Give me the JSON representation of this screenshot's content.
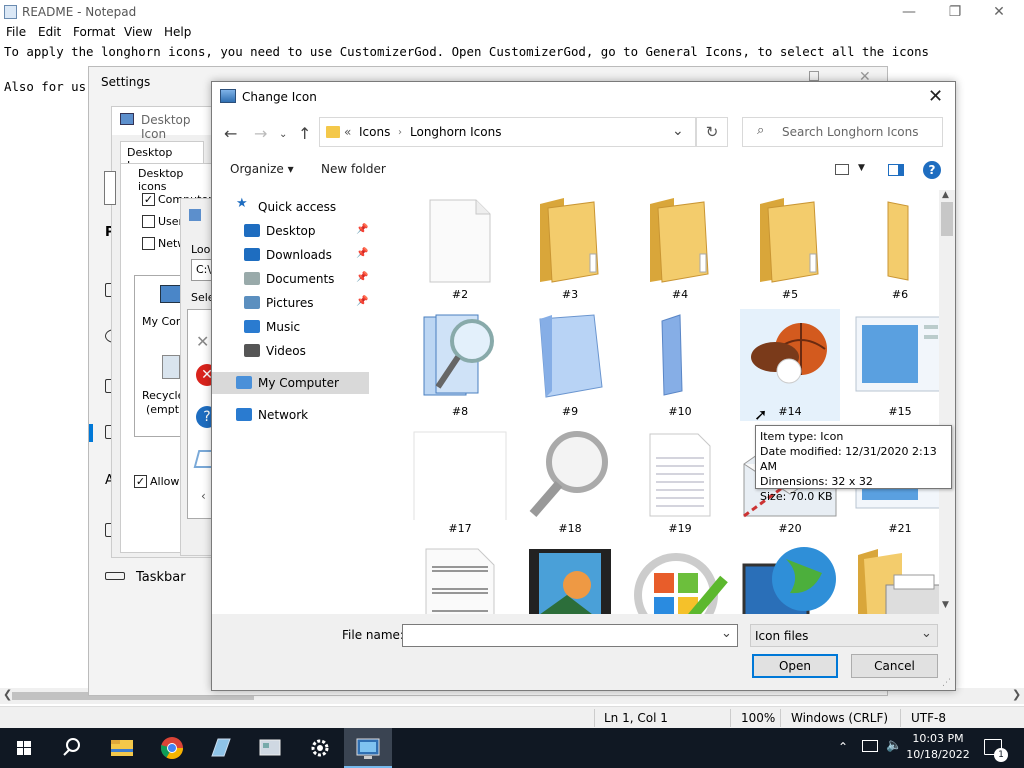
{
  "notepad": {
    "title": "README - Notepad",
    "menu": [
      "File",
      "Edit",
      "Format",
      "View",
      "Help"
    ],
    "line1": "To apply the longhorn icons, you need to use CustomizerGod. Open CustomizerGod, go to General Icons, to select all the icons",
    "line2": "Also for us",
    "status": {
      "pos": "Ln 1, Col 1",
      "zoom": "100%",
      "eol": "Windows (CRLF)",
      "enc": "UTF-8"
    }
  },
  "settings": {
    "title": "Settings",
    "taskbar_label": "Taskbar",
    "nav_letters": [
      "P",
      "A"
    ]
  },
  "desktop_icons": {
    "title": "Desktop Icon",
    "tab": "Desktop Icons",
    "group": "Desktop icons",
    "checks": [
      {
        "label": "Computer",
        "checked": true
      },
      {
        "label": "User",
        "checked": false
      },
      {
        "label": "Netw",
        "checked": false
      }
    ],
    "icons": [
      "My Comp",
      "Recycle",
      "(empt"
    ],
    "allow": "Allow t"
  },
  "look": {
    "label": "Look",
    "path": "C:\\",
    "select": "Selec"
  },
  "dialog": {
    "title": "Change Icon",
    "address": {
      "sep": "«",
      "parts": [
        "Icons",
        "Longhorn Icons"
      ]
    },
    "search_placeholder": "Search Longhorn Icons",
    "organize": "Organize ▾",
    "new_folder": "New folder",
    "sidebar": [
      {
        "label": "Quick access",
        "icon": "star-icon"
      },
      {
        "label": "Desktop",
        "icon": "desktop-icon",
        "pinned": true
      },
      {
        "label": "Downloads",
        "icon": "download-icon",
        "pinned": true
      },
      {
        "label": "Documents",
        "icon": "documents-icon",
        "pinned": true
      },
      {
        "label": "Pictures",
        "icon": "pictures-icon",
        "pinned": true
      },
      {
        "label": "Music",
        "icon": "music-icon"
      },
      {
        "label": "Videos",
        "icon": "videos-icon"
      },
      {
        "label": "My Computer",
        "icon": "computer-icon",
        "selected": true
      },
      {
        "label": "Network",
        "icon": "network-icon"
      }
    ],
    "items": [
      {
        "label": "#2",
        "kind": "blank-page"
      },
      {
        "label": "#3",
        "kind": "folder"
      },
      {
        "label": "#4",
        "kind": "folder"
      },
      {
        "label": "#5",
        "kind": "folder"
      },
      {
        "label": "#6",
        "kind": "folder-side"
      },
      {
        "label": "#8",
        "kind": "search-pages"
      },
      {
        "label": "#9",
        "kind": "blue-folder"
      },
      {
        "label": "#10",
        "kind": "blue-folder-side"
      },
      {
        "label": "#14",
        "kind": "balls"
      },
      {
        "label": "#15",
        "kind": "window"
      },
      {
        "label": "#17",
        "kind": "blank-box"
      },
      {
        "label": "#18",
        "kind": "magnifier"
      },
      {
        "label": "#19",
        "kind": "lined-page"
      },
      {
        "label": "#20",
        "kind": "envelope"
      },
      {
        "label": "#21",
        "kind": "window"
      },
      {
        "label": "",
        "kind": "sheet-music"
      },
      {
        "label": "",
        "kind": "film"
      },
      {
        "label": "",
        "kind": "windows-check"
      },
      {
        "label": "",
        "kind": "globe-monitor"
      },
      {
        "label": "",
        "kind": "folder-printer"
      }
    ],
    "file_name_label": "File name:",
    "file_name_value": "",
    "file_type": "Icon files",
    "open": "Open",
    "cancel": "Cancel",
    "tooltip": [
      "Item type: Icon",
      "Date modified: 12/31/2020 2:13 AM",
      "Dimensions: 32 x 32",
      "Size: 70.0 KB"
    ]
  },
  "taskbar": {
    "time": "10:03 PM",
    "date": "10/18/2022",
    "notif": "1"
  },
  "colors": {
    "accent": "#0078d7",
    "taskbar": "#101823",
    "selection": "#e5f1fb",
    "folder": "#f4c84a"
  }
}
